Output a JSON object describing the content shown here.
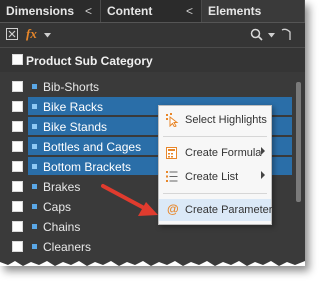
{
  "tabs": [
    {
      "label": "Dimensions",
      "active": false
    },
    {
      "label": "Content",
      "active": false
    },
    {
      "label": "Elements",
      "active": true
    }
  ],
  "tab_chevron": "<",
  "toolbar": {
    "fx_label": "fx",
    "icons": [
      "close-box-icon",
      "fx-icon",
      "dropdown-caret-icon",
      "search-icon",
      "dropdown-caret-icon",
      "more-icon"
    ]
  },
  "header": {
    "label": "Product Sub Category"
  },
  "items": [
    {
      "label": "Bib-Shorts",
      "selected": false
    },
    {
      "label": "Bike Racks",
      "selected": true
    },
    {
      "label": "Bike Stands",
      "selected": true
    },
    {
      "label": "Bottles and Cages",
      "selected": true
    },
    {
      "label": "Bottom Brackets",
      "selected": true
    },
    {
      "label": "Brakes",
      "selected": false
    },
    {
      "label": "Caps",
      "selected": false
    },
    {
      "label": "Chains",
      "selected": false
    },
    {
      "label": "Cleaners",
      "selected": false
    }
  ],
  "context_menu": {
    "items": [
      {
        "label": "Select Highlights",
        "icon": "cursor-highlight-icon",
        "submenu": false
      },
      {
        "label": "Create Formula",
        "icon": "calculator-icon",
        "submenu": true
      },
      {
        "label": "Create List",
        "icon": "list-icon",
        "submenu": true
      },
      {
        "label": "Create Parameter",
        "icon": "at-sign-icon",
        "submenu": false
      }
    ]
  },
  "colors": {
    "panel_bg": "#3a3a3a",
    "selection": "#2a6ea8",
    "bullet": "#5aa7e6",
    "fx_orange": "#e8872a",
    "arrow_red": "#e03b2e"
  }
}
